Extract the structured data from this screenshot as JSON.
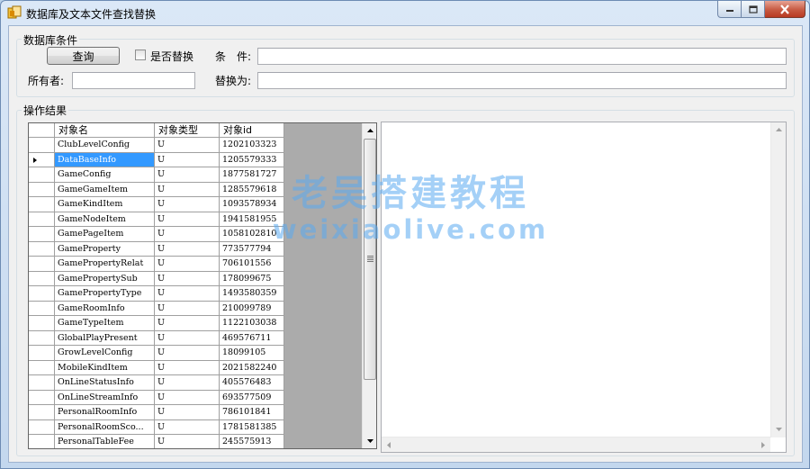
{
  "window": {
    "title": "数据库及文本文件查找替换"
  },
  "db_conditions": {
    "group_label": "数据库条件",
    "query_label": "查询",
    "replace_checkbox_label": "是否替换",
    "replace_checked": false,
    "condition_label": "条　件:",
    "condition_value": "",
    "owner_label": "所有者:",
    "owner_value": "",
    "replace_with_label": "替换为:",
    "replace_with_value": ""
  },
  "results": {
    "group_label": "操作结果",
    "columns": [
      "对象名",
      "对象类型",
      "对象id"
    ],
    "selected_row": 1,
    "rows": [
      {
        "name": "ClubLevelConfig",
        "type": "U",
        "id": "1202103323"
      },
      {
        "name": "DataBaseInfo",
        "type": "U",
        "id": "1205579333"
      },
      {
        "name": "GameConfig",
        "type": "U",
        "id": "1877581727"
      },
      {
        "name": "GameGameItem",
        "type": "U",
        "id": "1285579618"
      },
      {
        "name": "GameKindItem",
        "type": "U",
        "id": "1093578934"
      },
      {
        "name": "GameNodeItem",
        "type": "U",
        "id": "1941581955"
      },
      {
        "name": "GamePageItem",
        "type": "U",
        "id": "1058102810"
      },
      {
        "name": "GameProperty",
        "type": "U",
        "id": "773577794"
      },
      {
        "name": "GamePropertyRelat",
        "type": "U",
        "id": "706101556"
      },
      {
        "name": "GamePropertySub",
        "type": "U",
        "id": "178099675"
      },
      {
        "name": "GamePropertyType",
        "type": "U",
        "id": "1493580359"
      },
      {
        "name": "GameRoomInfo",
        "type": "U",
        "id": "210099789"
      },
      {
        "name": "GameTypeItem",
        "type": "U",
        "id": "1122103038"
      },
      {
        "name": "GlobalPlayPresent",
        "type": "U",
        "id": "469576711"
      },
      {
        "name": "GrowLevelConfig",
        "type": "U",
        "id": "18099105"
      },
      {
        "name": "MobileKindItem",
        "type": "U",
        "id": "2021582240"
      },
      {
        "name": "OnLineStatusInfo",
        "type": "U",
        "id": "405576483"
      },
      {
        "name": "OnLineStreamInfo",
        "type": "U",
        "id": "693577509"
      },
      {
        "name": "PersonalRoomInfo",
        "type": "U",
        "id": "786101841"
      },
      {
        "name": "PersonalRoomSco...",
        "type": "U",
        "id": "1781581385"
      },
      {
        "name": "PersonalTableFee",
        "type": "U",
        "id": "245575913"
      }
    ],
    "output_text": ""
  },
  "watermark": {
    "line1": "老吴搭建教程",
    "line2": "weixiaolive.com"
  },
  "colors": {
    "selection": "#3399ff",
    "grid_background": "#ababab",
    "close_button": "#c75a43"
  }
}
